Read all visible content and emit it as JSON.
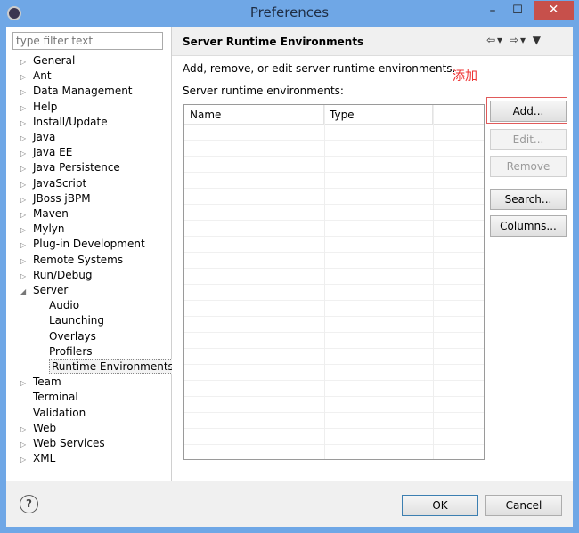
{
  "window": {
    "title": "Preferences",
    "min": "–",
    "max": "☐",
    "close": "✕"
  },
  "filter": {
    "placeholder": "type filter text"
  },
  "tree": [
    {
      "label": "General",
      "expander": "▷",
      "indent": 0
    },
    {
      "label": "Ant",
      "expander": "▷",
      "indent": 0
    },
    {
      "label": "Data Management",
      "expander": "▷",
      "indent": 0
    },
    {
      "label": "Help",
      "expander": "▷",
      "indent": 0
    },
    {
      "label": "Install/Update",
      "expander": "▷",
      "indent": 0
    },
    {
      "label": "Java",
      "expander": "▷",
      "indent": 0
    },
    {
      "label": "Java EE",
      "expander": "▷",
      "indent": 0
    },
    {
      "label": "Java Persistence",
      "expander": "▷",
      "indent": 0
    },
    {
      "label": "JavaScript",
      "expander": "▷",
      "indent": 0
    },
    {
      "label": "JBoss jBPM",
      "expander": "▷",
      "indent": 0
    },
    {
      "label": "Maven",
      "expander": "▷",
      "indent": 0
    },
    {
      "label": "Mylyn",
      "expander": "▷",
      "indent": 0
    },
    {
      "label": "Plug-in Development",
      "expander": "▷",
      "indent": 0
    },
    {
      "label": "Remote Systems",
      "expander": "▷",
      "indent": 0
    },
    {
      "label": "Run/Debug",
      "expander": "▷",
      "indent": 0
    },
    {
      "label": "Server",
      "expander": "◢",
      "indent": 0
    },
    {
      "label": "Audio",
      "expander": "",
      "indent": 1
    },
    {
      "label": "Launching",
      "expander": "",
      "indent": 1
    },
    {
      "label": "Overlays",
      "expander": "",
      "indent": 1
    },
    {
      "label": "Profilers",
      "expander": "",
      "indent": 1
    },
    {
      "label": "Runtime Environments",
      "expander": "",
      "indent": 1,
      "selected": true
    },
    {
      "label": "Team",
      "expander": "▷",
      "indent": 0
    },
    {
      "label": "Terminal",
      "expander": "",
      "indent": 0
    },
    {
      "label": "Validation",
      "expander": "",
      "indent": 0
    },
    {
      "label": "Web",
      "expander": "▷",
      "indent": 0
    },
    {
      "label": "Web Services",
      "expander": "▷",
      "indent": 0
    },
    {
      "label": "XML",
      "expander": "▷",
      "indent": 0
    }
  ],
  "page": {
    "title": "Server Runtime Environments",
    "nav": "⇦▾ ⇨▾ ▼",
    "description": "Add, remove, or edit server runtime environments.",
    "annotation": "添加",
    "list_label": "Server runtime environments:"
  },
  "table": {
    "columns": [
      "Name",
      "Type",
      ""
    ]
  },
  "buttons": {
    "add": "Add...",
    "edit": "Edit...",
    "remove": "Remove",
    "search": "Search...",
    "columns": "Columns..."
  },
  "footer": {
    "help": "?",
    "ok": "OK",
    "cancel": "Cancel"
  },
  "colors": {
    "title_bar": "#6fa7e6",
    "close": "#c7504b",
    "annotation": "#e33333"
  }
}
